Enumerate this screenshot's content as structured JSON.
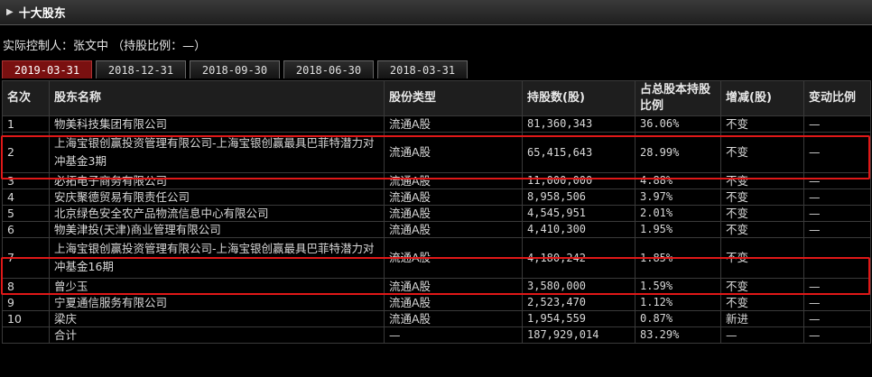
{
  "section": {
    "title": "十大股东"
  },
  "controller_text": "实际控制人：张文中 （持股比例：—）",
  "tabs": [
    {
      "label": "2019-03-31",
      "active": true
    },
    {
      "label": "2018-12-31",
      "active": false
    },
    {
      "label": "2018-09-30",
      "active": false
    },
    {
      "label": "2018-06-30",
      "active": false
    },
    {
      "label": "2018-03-31",
      "active": false
    }
  ],
  "columns": [
    "名次",
    "股东名称",
    "股份类型",
    "持股数(股)",
    "占总股本持股比例",
    "增减(股)",
    "变动比例"
  ],
  "rows": [
    {
      "rank": "1",
      "name": "物美科技集团有限公司",
      "type": "流通A股",
      "shares": "81,360,343",
      "ratio": "36.06%",
      "change": "不变",
      "change_ratio": "—",
      "tall": false
    },
    {
      "rank": "2",
      "name": "上海宝银创赢投资管理有限公司-上海宝银创赢最具巴菲特潜力对冲基金3期",
      "type": "流通A股",
      "shares": "65,415,643",
      "ratio": "28.99%",
      "change": "不变",
      "change_ratio": "—",
      "tall": true
    },
    {
      "rank": "3",
      "name": "必拓电子商务有限公司",
      "type": "流通A股",
      "shares": "11,000,000",
      "ratio": "4.88%",
      "change": "不变",
      "change_ratio": "—",
      "tall": false
    },
    {
      "rank": "4",
      "name": "安庆聚德贸易有限责任公司",
      "type": "流通A股",
      "shares": "8,958,506",
      "ratio": "3.97%",
      "change": "不变",
      "change_ratio": "—",
      "tall": false
    },
    {
      "rank": "5",
      "name": "北京绿色安全农产品物流信息中心有限公司",
      "type": "流通A股",
      "shares": "4,545,951",
      "ratio": "2.01%",
      "change": "不变",
      "change_ratio": "—",
      "tall": false
    },
    {
      "rank": "6",
      "name": "物美津投(天津)商业管理有限公司",
      "type": "流通A股",
      "shares": "4,410,300",
      "ratio": "1.95%",
      "change": "不变",
      "change_ratio": "—",
      "tall": false
    },
    {
      "rank": "7",
      "name": "上海宝银创赢投资管理有限公司-上海宝银创赢最具巴菲特潜力对冲基金16期",
      "type": "流通A股",
      "shares": "4,180,242",
      "ratio": "1.85%",
      "change": "不变",
      "change_ratio": "—",
      "tall": true
    },
    {
      "rank": "8",
      "name": "曾少玉",
      "type": "流通A股",
      "shares": "3,580,000",
      "ratio": "1.59%",
      "change": "不变",
      "change_ratio": "—",
      "tall": false
    },
    {
      "rank": "9",
      "name": "宁夏通信服务有限公司",
      "type": "流通A股",
      "shares": "2,523,470",
      "ratio": "1.12%",
      "change": "不变",
      "change_ratio": "—",
      "tall": false
    },
    {
      "rank": "10",
      "name": "梁庆",
      "type": "流通A股",
      "shares": "1,954,559",
      "ratio": "0.87%",
      "change": "新进",
      "change_ratio": "—",
      "tall": false
    }
  ],
  "total": {
    "label": "合计",
    "type": "—",
    "shares": "187,929,014",
    "ratio": "83.29%",
    "change": "—",
    "change_ratio": "—"
  },
  "colors": {
    "active_tab": "#7a1010",
    "highlight_border": "#e01818",
    "background": "#000000"
  }
}
